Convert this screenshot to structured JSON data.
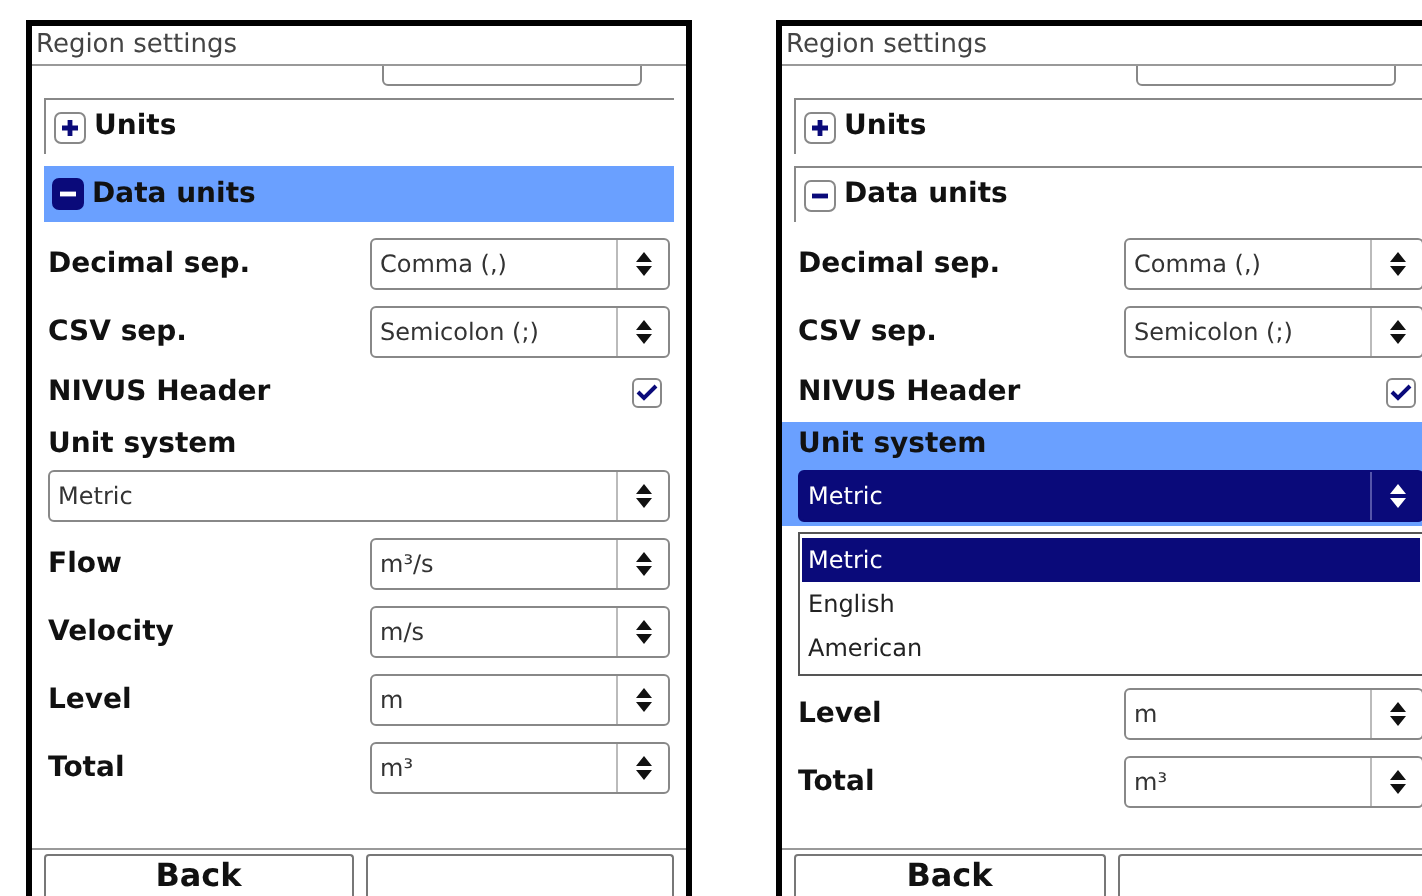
{
  "screens": [
    {
      "title": "Region settings",
      "groups": [
        {
          "label": "Units",
          "expanded": false,
          "selected": false
        },
        {
          "label": "Data units",
          "expanded": true,
          "selected": true
        }
      ],
      "rows": [
        {
          "kind": "select",
          "label": "Decimal sep.",
          "value": "Comma (,)"
        },
        {
          "kind": "select",
          "label": "CSV sep.",
          "value": "Semicolon (;)"
        },
        {
          "kind": "checkbox",
          "label": "NIVUS Header",
          "checked": true
        },
        {
          "kind": "wide_select",
          "label": "Unit system",
          "value": "Metric",
          "selected": false
        },
        {
          "kind": "select",
          "label": "Flow",
          "value": "m³/s"
        },
        {
          "kind": "select",
          "label": "Velocity",
          "value": "m/s"
        },
        {
          "kind": "select",
          "label": "Level",
          "value": "m"
        },
        {
          "kind": "select",
          "label": "Total",
          "value": "m³"
        }
      ],
      "buttons": [
        {
          "kind": "label",
          "label": "Back"
        },
        {
          "kind": "blank"
        }
      ]
    },
    {
      "title": "Region settings",
      "groups": [
        {
          "label": "Units",
          "expanded": false,
          "selected": false
        },
        {
          "label": "Data units",
          "expanded": true,
          "selected": false
        }
      ],
      "rows": [
        {
          "kind": "select",
          "label": "Decimal sep.",
          "value": "Comma (,)"
        },
        {
          "kind": "select",
          "label": "CSV sep.",
          "value": "Semicolon (;)"
        },
        {
          "kind": "checkbox",
          "label": "NIVUS Header",
          "checked": true
        },
        {
          "kind": "wide_select",
          "label": "Unit system",
          "value": "Metric",
          "selected": true,
          "options": [
            {
              "label": "Metric",
              "selected": true
            },
            {
              "label": "English",
              "selected": false
            },
            {
              "label": "American",
              "selected": false
            }
          ]
        },
        {
          "kind": "select",
          "label": "Level",
          "value": "m"
        },
        {
          "kind": "select",
          "label": "Total",
          "value": "m³"
        }
      ],
      "buttons": [
        {
          "kind": "label",
          "label": "Back"
        },
        {
          "kind": "blank"
        }
      ]
    }
  ]
}
